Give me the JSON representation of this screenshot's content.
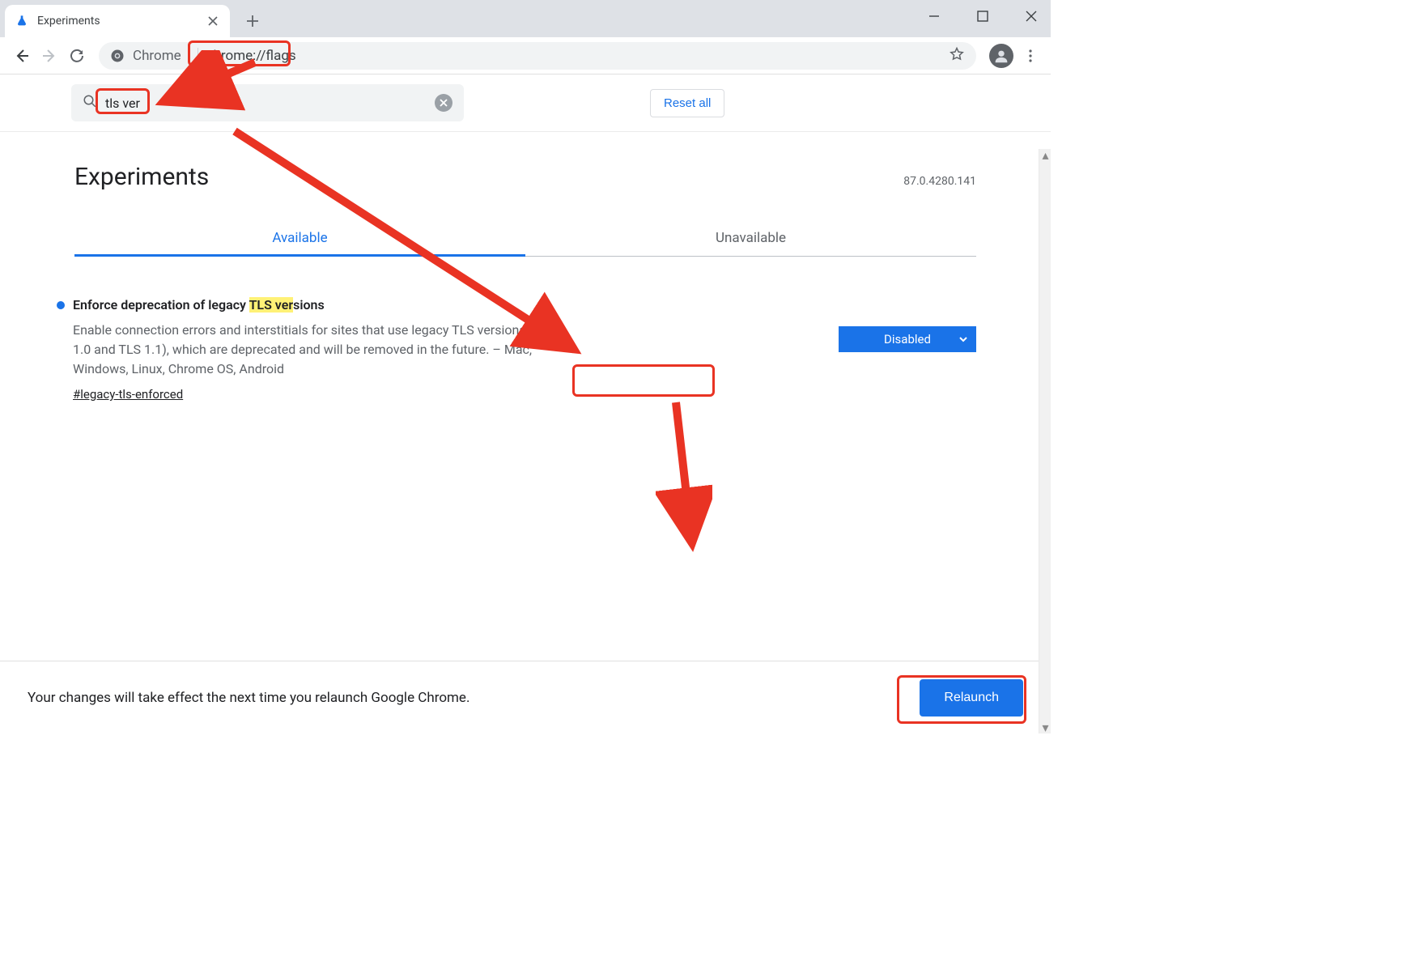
{
  "browser": {
    "tab_title": "Experiments",
    "address_chip": "Chrome",
    "address_url": "chrome://flags"
  },
  "search": {
    "value": "tls ver",
    "reset_label": "Reset all"
  },
  "page": {
    "title": "Experiments",
    "version": "87.0.4280.141",
    "tabs": {
      "available": "Available",
      "unavailable": "Unavailable"
    }
  },
  "flag": {
    "title_pre": "Enforce deprecation of legacy ",
    "title_hl": "TLS ver",
    "title_post": "sions",
    "description": "Enable connection errors and interstitials for sites that use legacy TLS versions (TLS 1.0 and TLS 1.1), which are deprecated and will be removed in the future. – Mac, Windows, Linux, Chrome OS, Android",
    "hash": "#legacy-tls-enforced",
    "select_value": "Disabled"
  },
  "footer": {
    "message": "Your changes will take effect the next time you relaunch Google Chrome.",
    "relaunch_label": "Relaunch"
  }
}
